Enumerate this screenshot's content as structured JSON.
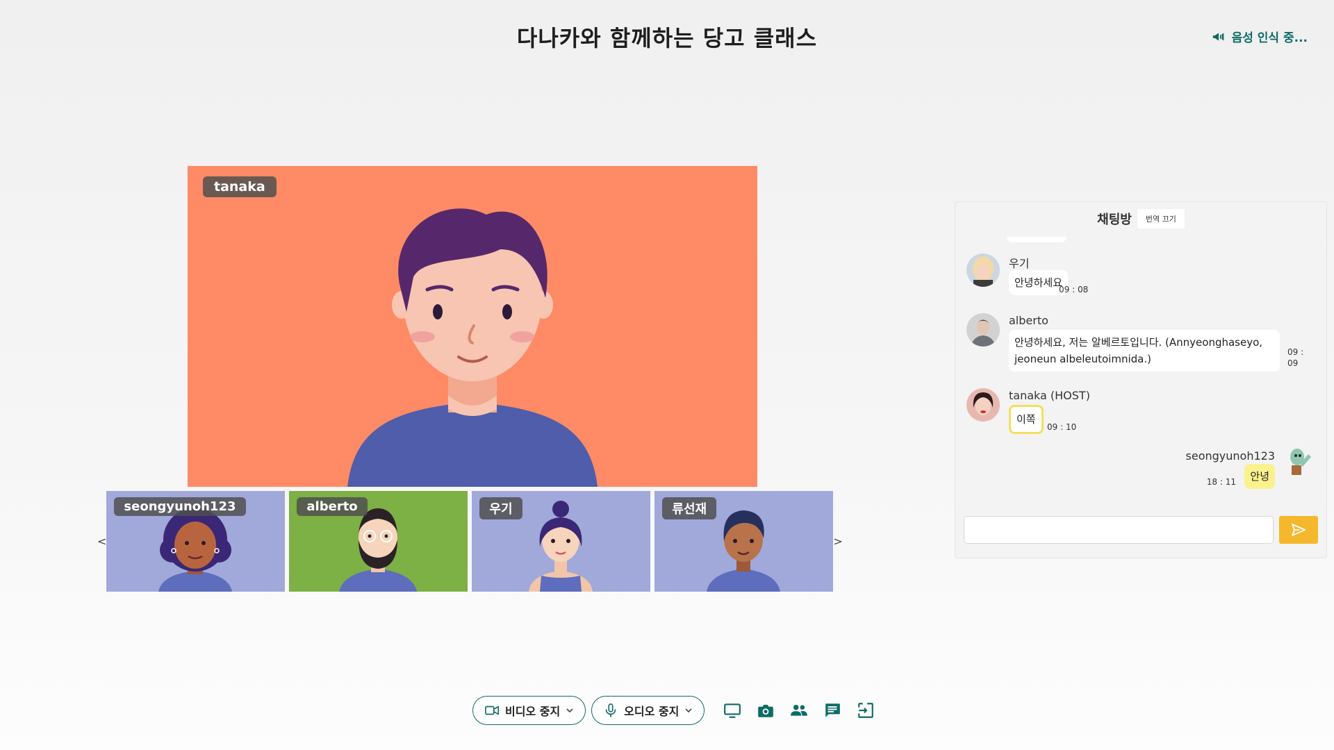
{
  "header": {
    "title": "다나카와 함께하는 당고 클래스",
    "voice_status": "음성 인식 중..."
  },
  "main_video": {
    "participant": "tanaka"
  },
  "thumbnails": {
    "prev_arrow": "<",
    "next_arrow": ">",
    "participants": [
      "seongyunoh123",
      "alberto",
      "우기",
      "류선재"
    ]
  },
  "chat": {
    "title": "채팅방",
    "translate_toggle": "번역 끄기",
    "messages": [
      {
        "sender": "우기",
        "text": "안녕하세요",
        "time": "09 : 08"
      },
      {
        "sender": "alberto",
        "text": "안녕하세요, 저는 알베르토입니다. (Annyeonghaseyo, jeoneun albeleutoimnida.)",
        "time": "09 : 09"
      },
      {
        "sender": "tanaka (HOST)",
        "text": "이쪽",
        "time": "09 : 10"
      },
      {
        "sender": "seongyunoh123",
        "text": "안녕",
        "time": "18 : 11"
      }
    ],
    "input_value": "",
    "input_placeholder": ""
  },
  "toolbar": {
    "video_stop": "비디오 중지",
    "audio_stop": "오디오 중지"
  },
  "colors": {
    "accent": "#0e6b66",
    "main_video_bg": "#ff8a66",
    "send_button": "#f5b82c",
    "mine_bubble": "#fbf28d",
    "highlight_border": "#f3df5f"
  }
}
